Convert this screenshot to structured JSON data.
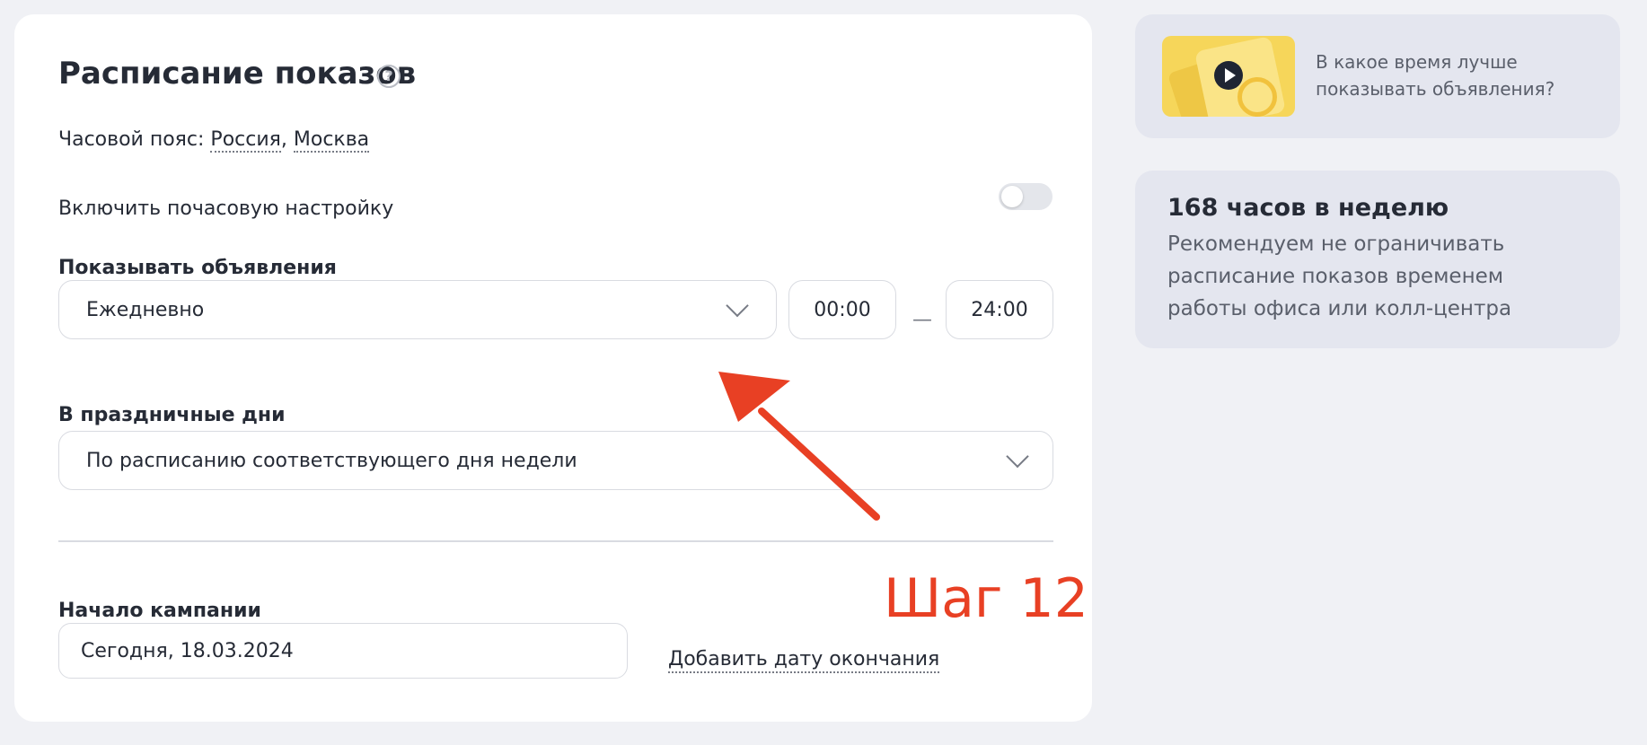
{
  "schedule": {
    "title": "Расписание показов",
    "timezone_label": "Часовой пояс:",
    "timezone_country": "Россия",
    "timezone_city": "Москва",
    "hourly_toggle_label": "Включить почасовую настройку",
    "hourly_toggle_on": false,
    "show_ads_label": "Показывать объявления",
    "show_ads_value": "Ежедневно",
    "time_from": "00:00",
    "time_to": "24:00",
    "holidays_label": "В праздничные дни",
    "holidays_value": "По расписанию соответствующего дня недели",
    "campaign_start_label": "Начало кампании",
    "campaign_start_value": "Сегодня, 18.03.2024",
    "add_end_date_label": "Добавить дату окончания"
  },
  "annotation": {
    "step_label": "Шаг 12",
    "color": "#e84024"
  },
  "sidebar": {
    "video_card_text": "В какое время лучше показывать объявления?",
    "info_title": "168 часов в неделю",
    "info_text": "Рекомендуем не ограничивать расписание показов временем работы офиса или колл-центра"
  },
  "icons": {
    "help": "question-circle-icon",
    "chevron": "chevron-down-icon",
    "play": "play-icon"
  }
}
